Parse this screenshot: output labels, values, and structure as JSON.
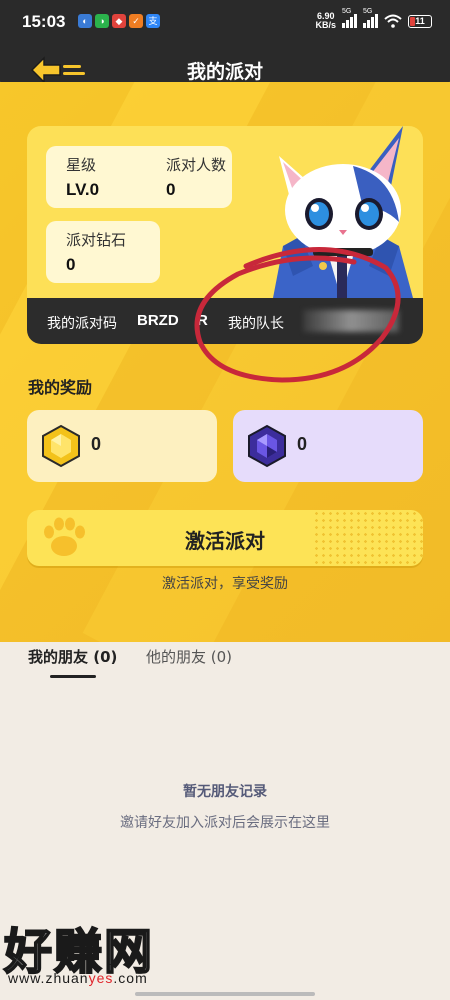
{
  "status": {
    "time": "15:03",
    "speed_top": "6.90",
    "speed_bottom": "KB/s",
    "sig1": "5G",
    "sig2": "5G",
    "battery": "11"
  },
  "header": {
    "title": "我的派对"
  },
  "stats": {
    "level_label": "星级",
    "level_value": "LV.0",
    "people_label": "派对人数",
    "people_value": "0",
    "diamond_label": "派对钻石",
    "diamond_value": "0"
  },
  "party_bar": {
    "code_label": "我的派对码",
    "code_value": "BRZD",
    "code_partial": "R",
    "captain_label": "我的队长"
  },
  "rewards": {
    "title": "我的奖励",
    "gold_value": "0",
    "purple_value": "0"
  },
  "activate": {
    "button_label": "激活派对",
    "subtitle": "激活派对，享受奖励"
  },
  "friends": {
    "tab_mine": "我的朋友 (0)",
    "tab_theirs": "他的朋友 (0)",
    "empty_title": "暂无朋友记录",
    "empty_desc": "邀请好友加入派对后会展示在这里"
  },
  "watermark": {
    "big": "好赚网",
    "url_pre": "www.zhuan",
    "url_yes": "yes",
    "url_post": ".com"
  },
  "colors": {
    "yellow": "#f4c02a",
    "card": "#fde057",
    "dark": "#2a2a2a",
    "annotation_red": "#c8283a"
  }
}
